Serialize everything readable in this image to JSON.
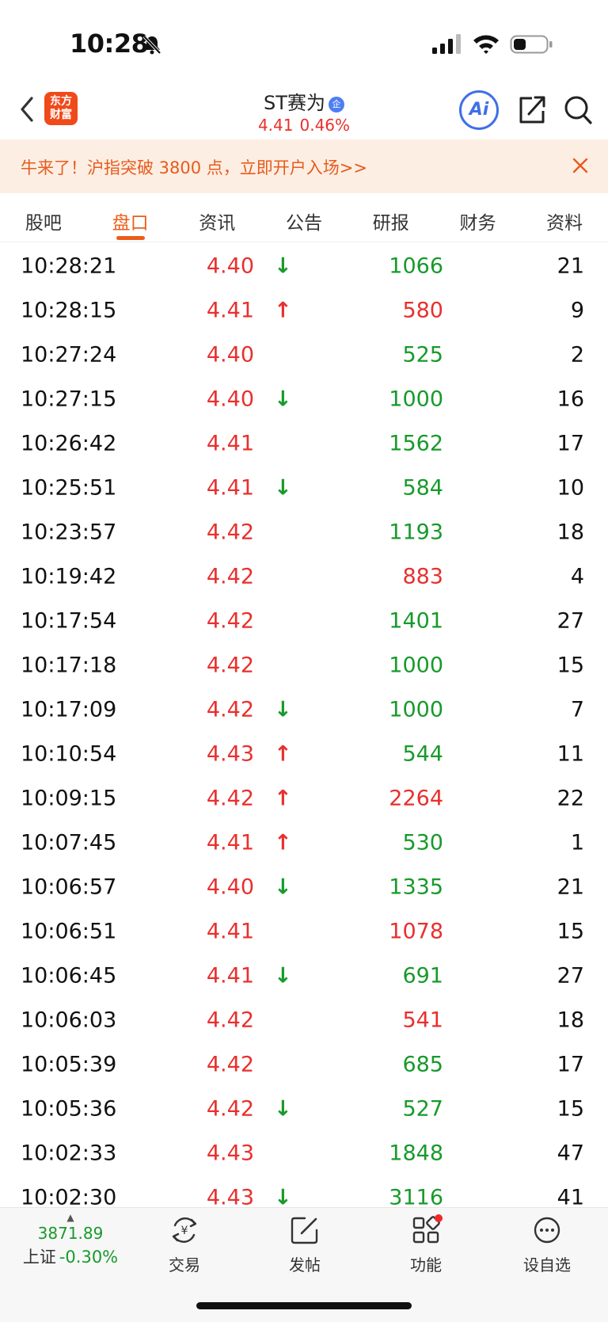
{
  "status_bar": {
    "time": "10:28"
  },
  "header": {
    "logo_line1": "东方",
    "logo_line2": "财富",
    "stock_name": "ST赛为",
    "badge": "企",
    "price": "4.41",
    "change_pct": "0.46%",
    "ai_label": "Ai"
  },
  "promo": {
    "text": "牛来了！沪指突破 3800 点，立即开户入场>>"
  },
  "tabs": [
    {
      "label": "股吧"
    },
    {
      "label": "盘口",
      "active": true
    },
    {
      "label": "资讯"
    },
    {
      "label": "公告"
    },
    {
      "label": "研报"
    },
    {
      "label": "财务"
    },
    {
      "label": "资料"
    }
  ],
  "trades": [
    {
      "time": "10:28:21",
      "price": "4.40",
      "arrow": "↓",
      "dir": "down",
      "volume": "1066",
      "side": "sell",
      "count": "21"
    },
    {
      "time": "10:28:15",
      "price": "4.41",
      "arrow": "↑",
      "dir": "up",
      "volume": "580",
      "side": "buy",
      "count": "9"
    },
    {
      "time": "10:27:24",
      "price": "4.40",
      "arrow": "",
      "dir": "none",
      "volume": "525",
      "side": "sell",
      "count": "2"
    },
    {
      "time": "10:27:15",
      "price": "4.40",
      "arrow": "↓",
      "dir": "down",
      "volume": "1000",
      "side": "sell",
      "count": "16"
    },
    {
      "time": "10:26:42",
      "price": "4.41",
      "arrow": "",
      "dir": "none",
      "volume": "1562",
      "side": "sell",
      "count": "17"
    },
    {
      "time": "10:25:51",
      "price": "4.41",
      "arrow": "↓",
      "dir": "down",
      "volume": "584",
      "side": "sell",
      "count": "10"
    },
    {
      "time": "10:23:57",
      "price": "4.42",
      "arrow": "",
      "dir": "none",
      "volume": "1193",
      "side": "sell",
      "count": "18"
    },
    {
      "time": "10:19:42",
      "price": "4.42",
      "arrow": "",
      "dir": "none",
      "volume": "883",
      "side": "buy",
      "count": "4"
    },
    {
      "time": "10:17:54",
      "price": "4.42",
      "arrow": "",
      "dir": "none",
      "volume": "1401",
      "side": "sell",
      "count": "27"
    },
    {
      "time": "10:17:18",
      "price": "4.42",
      "arrow": "",
      "dir": "none",
      "volume": "1000",
      "side": "sell",
      "count": "15"
    },
    {
      "time": "10:17:09",
      "price": "4.42",
      "arrow": "↓",
      "dir": "down",
      "volume": "1000",
      "side": "sell",
      "count": "7"
    },
    {
      "time": "10:10:54",
      "price": "4.43",
      "arrow": "↑",
      "dir": "up",
      "volume": "544",
      "side": "sell",
      "count": "11"
    },
    {
      "time": "10:09:15",
      "price": "4.42",
      "arrow": "↑",
      "dir": "up",
      "volume": "2264",
      "side": "buy",
      "count": "22"
    },
    {
      "time": "10:07:45",
      "price": "4.41",
      "arrow": "↑",
      "dir": "up",
      "volume": "530",
      "side": "sell",
      "count": "1"
    },
    {
      "time": "10:06:57",
      "price": "4.40",
      "arrow": "↓",
      "dir": "down",
      "volume": "1335",
      "side": "sell",
      "count": "21"
    },
    {
      "time": "10:06:51",
      "price": "4.41",
      "arrow": "",
      "dir": "none",
      "volume": "1078",
      "side": "buy",
      "count": "15"
    },
    {
      "time": "10:06:45",
      "price": "4.41",
      "arrow": "↓",
      "dir": "down",
      "volume": "691",
      "side": "sell",
      "count": "27"
    },
    {
      "time": "10:06:03",
      "price": "4.42",
      "arrow": "",
      "dir": "none",
      "volume": "541",
      "side": "buy",
      "count": "18"
    },
    {
      "time": "10:05:39",
      "price": "4.42",
      "arrow": "",
      "dir": "none",
      "volume": "685",
      "side": "sell",
      "count": "17"
    },
    {
      "time": "10:05:36",
      "price": "4.42",
      "arrow": "↓",
      "dir": "down",
      "volume": "527",
      "side": "sell",
      "count": "15"
    },
    {
      "time": "10:02:33",
      "price": "4.43",
      "arrow": "",
      "dir": "none",
      "volume": "1848",
      "side": "sell",
      "count": "47"
    },
    {
      "time": "10:02:30",
      "price": "4.43",
      "arrow": "↓",
      "dir": "down",
      "volume": "3116",
      "side": "sell",
      "count": "41"
    }
  ],
  "bottom_bar": {
    "index_value": "3871.89",
    "index_name": "上证",
    "index_change": "-0.30%",
    "items": [
      {
        "label": "交易",
        "icon": "trade-icon"
      },
      {
        "label": "发帖",
        "icon": "post-icon"
      },
      {
        "label": "功能",
        "icon": "function-icon"
      },
      {
        "label": "设自选",
        "icon": "more-icon"
      }
    ]
  },
  "colors": {
    "up": "#e8302e",
    "down": "#179a2b",
    "accent": "#ec5d1a",
    "ai": "#3f6fe8"
  }
}
